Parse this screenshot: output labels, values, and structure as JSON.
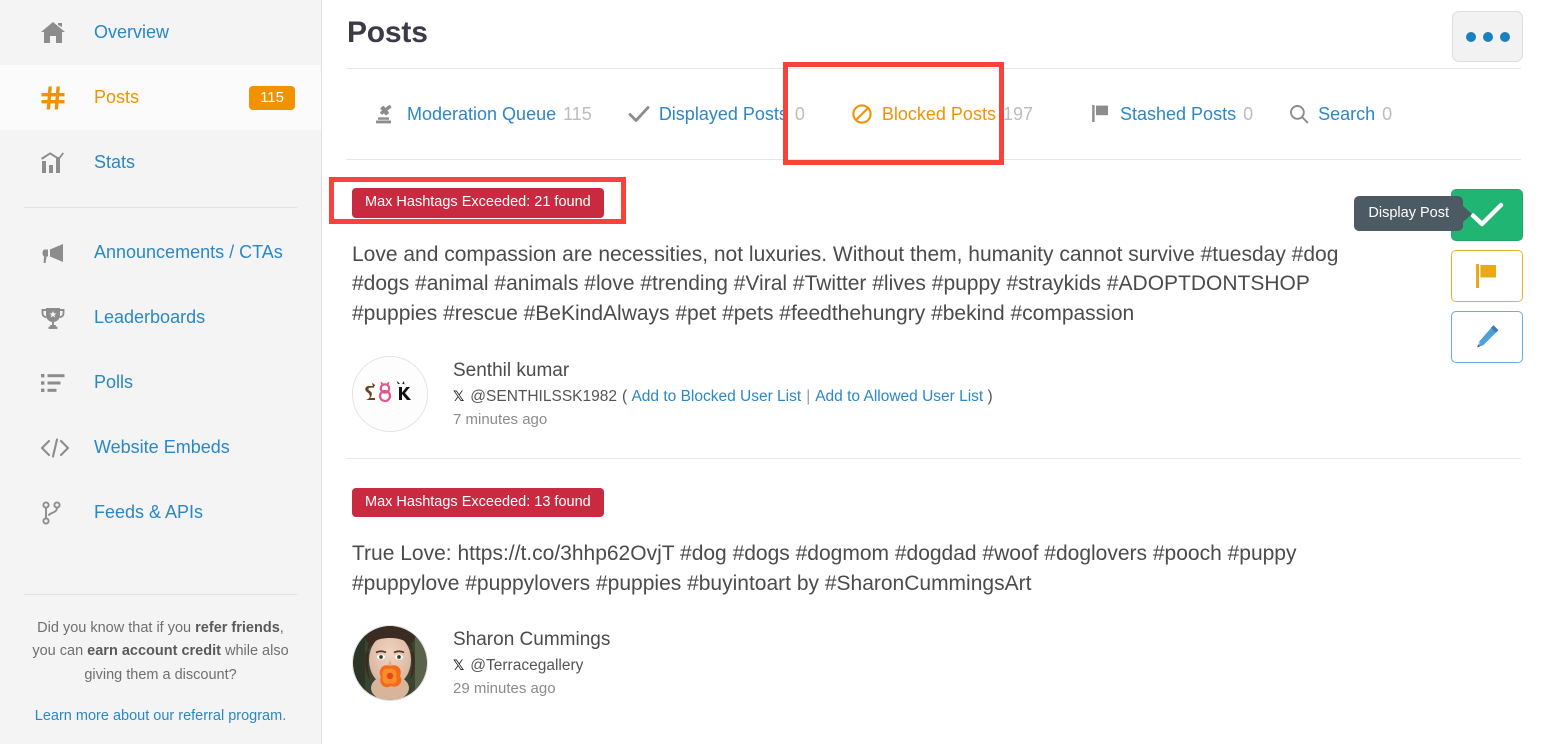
{
  "sidebar": {
    "group1": [
      {
        "label": "Overview",
        "icon": "home-icon",
        "active": false,
        "badge": ""
      },
      {
        "label": "Posts",
        "icon": "hash-icon",
        "active": true,
        "badge": "115"
      },
      {
        "label": "Stats",
        "icon": "chart-icon",
        "active": false,
        "badge": ""
      }
    ],
    "group2": [
      {
        "label": "Announcements / CTAs",
        "icon": "megaphone-icon"
      },
      {
        "label": "Leaderboards",
        "icon": "trophy-icon"
      },
      {
        "label": "Polls",
        "icon": "list-icon"
      },
      {
        "label": "Website Embeds",
        "icon": "code-icon"
      },
      {
        "label": "Feeds & APIs",
        "icon": "branch-icon"
      }
    ],
    "referral": {
      "line1_a": "Did you know that if you ",
      "line1_b": "refer friends",
      "line1_c": ", you can ",
      "line1_d": "earn account credit",
      "line1_e": " while also giving them a discount?",
      "link": "Learn more about our referral program."
    }
  },
  "header": {
    "title": "Posts",
    "more_button": "more-options"
  },
  "tabs": [
    {
      "label": "Moderation Queue",
      "count": "115",
      "icon": "gavel-icon",
      "active": false
    },
    {
      "label": "Displayed Posts",
      "count": "0",
      "icon": "check-icon",
      "active": false
    },
    {
      "label": "Blocked Posts",
      "count": "197",
      "icon": "blocked-icon",
      "active": true
    },
    {
      "label": "Stashed Posts",
      "count": "0",
      "icon": "flag-icon",
      "active": false
    },
    {
      "label": "Search",
      "count": "0",
      "icon": "search-icon",
      "active": false
    }
  ],
  "actions": {
    "tooltip": "Display Post",
    "approve": "display-post",
    "stash": "stash-post",
    "edit": "edit-post"
  },
  "posts": [
    {
      "flag": "Max Hashtags Exceeded: 21 found",
      "text": "Love and compassion are necessities, not luxuries. Without them, humanity cannot survive #tuesday #dog #dogs #animal #animals #love #trending #Viral #Twitter #lives #puppy #straykids #ADOPTDONTSHOP #puppies #rescue #BeKindAlways #pet #pets #feedthehungry #bekind #compassion",
      "author_name": "Senthil kumar",
      "handle": "@SENTHILSSK1982",
      "block_link": "Add to Blocked User List",
      "allow_link": "Add to Allowed User List",
      "timestamp": "7 minutes ago",
      "avatar_type": "logo-s8k"
    },
    {
      "flag": "Max Hashtags Exceeded: 13 found",
      "text": "True Love: https://t.co/3hhp62OvjT #dog #dogs #dogmom #dogdad #woof #doglovers #pooch #puppy #puppylove #puppylovers #puppies #buyintoart by #SharonCummingsArt",
      "author_name": "Sharon Cummings",
      "handle": "@Terracegallery",
      "block_link": "",
      "allow_link": "",
      "timestamp": "29 minutes ago",
      "avatar_type": "photo-woman"
    }
  ],
  "colors": {
    "accent_orange": "#f39200",
    "link_blue": "#2a87c8",
    "flag_red": "#ca2a3f",
    "annotation_red": "#f9423a",
    "approve_green": "#21b573",
    "tooltip_bg": "#4c5a64"
  }
}
